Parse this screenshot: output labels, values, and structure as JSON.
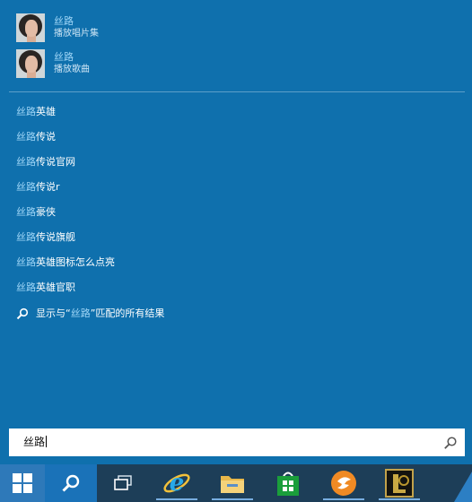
{
  "media_results": [
    {
      "title": "丝路",
      "subtitle": "播放唱片集"
    },
    {
      "title": "丝路",
      "subtitle": "播放歌曲"
    }
  ],
  "suggestions": [
    {
      "highlight": "丝路",
      "rest": "英雄"
    },
    {
      "highlight": "丝路",
      "rest": "传说"
    },
    {
      "highlight": "丝路",
      "rest": "传说官网"
    },
    {
      "highlight": "丝路",
      "rest": "传说r"
    },
    {
      "highlight": "丝路",
      "rest": "豪侠"
    },
    {
      "highlight": "丝路",
      "rest": "传说旗舰"
    },
    {
      "highlight": "丝路",
      "rest": "英雄图标怎么点亮"
    },
    {
      "highlight": "丝路",
      "rest": "英雄官职"
    }
  ],
  "show_all": {
    "prefix": "显示与“",
    "query": "丝路",
    "suffix": "”匹配的所有结果"
  },
  "search": {
    "value": "丝路"
  },
  "taskbar": {
    "apps": [
      "start-icon",
      "search-icon",
      "task-view-icon",
      "internet-explorer-icon",
      "file-explorer-icon",
      "store-icon",
      "thunder-icon",
      "league-of-legends-icon"
    ]
  },
  "colors": {
    "accent": "#0f70ad",
    "highlight_text": "#9fd6f7",
    "taskbar": "#1d3e58"
  }
}
